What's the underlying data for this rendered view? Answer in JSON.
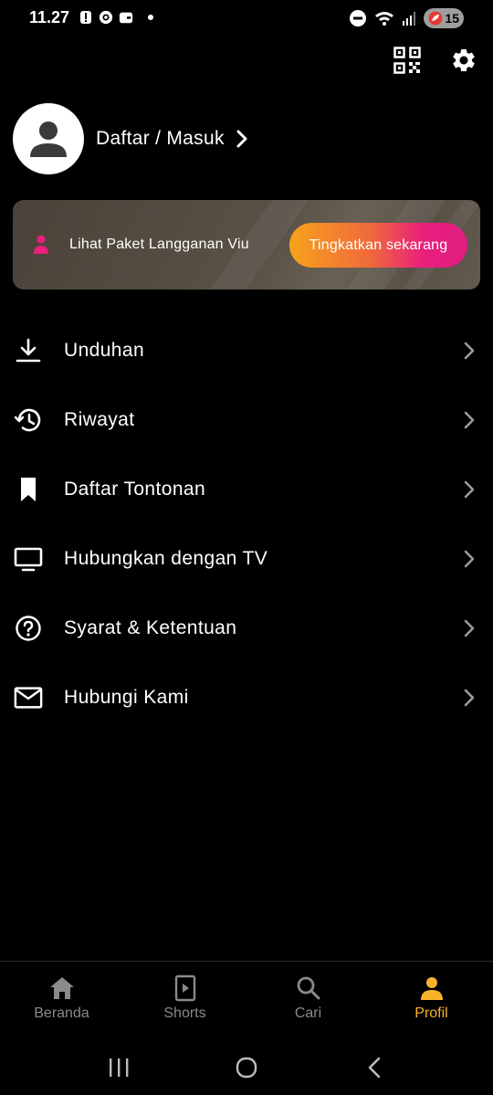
{
  "status_bar": {
    "time": "11.27",
    "battery": "15"
  },
  "profile": {
    "login_label": "Daftar / Masuk"
  },
  "subscription": {
    "text": "Lihat Paket Langganan Viu",
    "button": "Tingkatkan sekarang"
  },
  "menu": [
    {
      "label": "Unduhan",
      "icon": "download-icon"
    },
    {
      "label": "Riwayat",
      "icon": "history-icon"
    },
    {
      "label": "Daftar Tontonan",
      "icon": "bookmark-icon"
    },
    {
      "label": "Hubungkan dengan TV",
      "icon": "tv-icon"
    },
    {
      "label": "Syarat & Ketentuan",
      "icon": "help-icon"
    },
    {
      "label": "Hubungi Kami",
      "icon": "mail-icon"
    }
  ],
  "bottom_nav": [
    {
      "label": "Beranda",
      "icon": "home-icon",
      "active": false
    },
    {
      "label": "Shorts",
      "icon": "shorts-icon",
      "active": false
    },
    {
      "label": "Cari",
      "icon": "search-icon",
      "active": false
    },
    {
      "label": "Profil",
      "icon": "profile-icon",
      "active": true
    }
  ],
  "colors": {
    "accent": "#f6b32c",
    "pink": "#e8207c",
    "inactive": "#8a8a8a"
  }
}
